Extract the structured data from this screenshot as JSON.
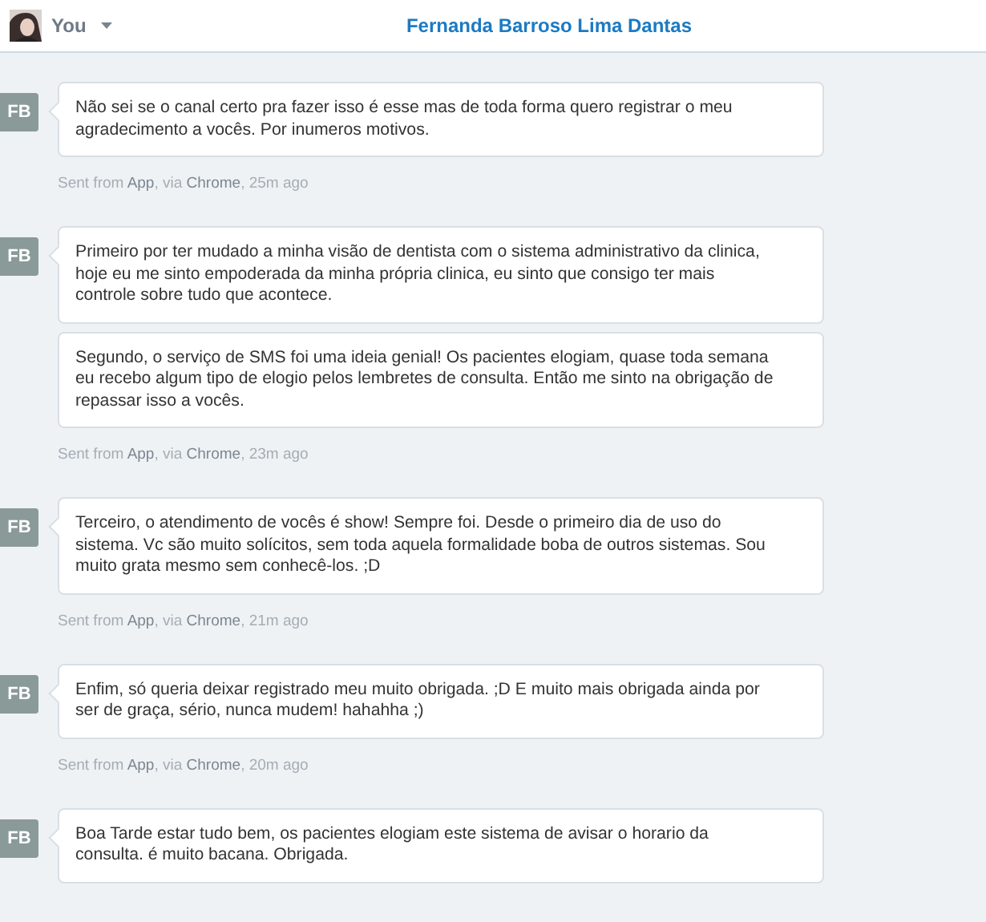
{
  "header": {
    "user": {
      "label": "You"
    },
    "title": "Fernanda Barroso Lima Dantas"
  },
  "groups": [
    {
      "initials": "FB",
      "messages": [
        "Não sei se o canal certo pra fazer isso é esse mas de toda forma quero registrar o meu agradecimento a vocês. Por inumeros motivos."
      ],
      "meta": [
        {
          "text": "Sent from ",
          "emphasis": false
        },
        {
          "text": "App",
          "emphasis": true
        },
        {
          "text": ", via ",
          "emphasis": false
        },
        {
          "text": "Chrome",
          "emphasis": true
        },
        {
          "text": ", 25m ago",
          "emphasis": false
        }
      ]
    },
    {
      "initials": "FB",
      "messages": [
        "Primeiro por ter mudado a minha visão de dentista com o sistema administrativo da clinica, hoje eu me sinto empoderada da minha própria clinica, eu sinto que consigo ter mais controle sobre tudo que acontece.",
        "Segundo, o serviço de SMS foi uma ideia genial! Os pacientes elogiam, quase toda semana eu recebo algum tipo de elogio pelos lembretes de consulta. Então me sinto na obrigação de repassar isso a vocês."
      ],
      "meta": [
        {
          "text": "Sent from ",
          "emphasis": false
        },
        {
          "text": "App",
          "emphasis": true
        },
        {
          "text": ", via ",
          "emphasis": false
        },
        {
          "text": "Chrome",
          "emphasis": true
        },
        {
          "text": ", 23m ago",
          "emphasis": false
        }
      ]
    },
    {
      "initials": "FB",
      "messages": [
        "Terceiro, o atendimento de vocês é show! Sempre foi. Desde o primeiro dia de uso do sistema. Vc são muito solícitos, sem toda aquela formalidade boba de outros sistemas. Sou muito grata mesmo sem conhecê-los. ;D"
      ],
      "meta": [
        {
          "text": "Sent from ",
          "emphasis": false
        },
        {
          "text": "App",
          "emphasis": true
        },
        {
          "text": ", via ",
          "emphasis": false
        },
        {
          "text": "Chrome",
          "emphasis": true
        },
        {
          "text": ", 21m ago",
          "emphasis": false
        }
      ]
    },
    {
      "initials": "FB",
      "messages": [
        "Enfim, só queria deixar registrado meu muito obrigada. ;D E muito mais obrigada ainda por ser de graça, sério, nunca mudem! hahahha ;)"
      ],
      "meta": [
        {
          "text": "Sent from ",
          "emphasis": false
        },
        {
          "text": "App",
          "emphasis": true
        },
        {
          "text": ", via ",
          "emphasis": false
        },
        {
          "text": "Chrome",
          "emphasis": true
        },
        {
          "text": ", 20m ago",
          "emphasis": false
        }
      ]
    },
    {
      "initials": "FB",
      "messages": [
        "Boa Tarde estar tudo bem, os pacientes elogiam este sistema de avisar o horario da consulta. é muito bacana. Obrigada."
      ]
    }
  ]
}
